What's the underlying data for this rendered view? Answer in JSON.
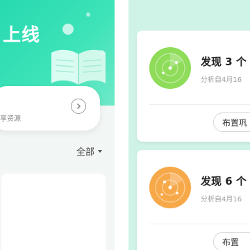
{
  "left_panel": {
    "hero_title": "上线",
    "hero_card_subtitle": "享资源",
    "filter_label": "全部"
  },
  "right_panel": {
    "cards": [
      {
        "title": "发现 3 个",
        "subtitle": "分析自4月16",
        "button_label": "布置巩",
        "radar_color": "#8fdc5a"
      },
      {
        "title": "发现 6 个",
        "subtitle": "分析自4月16",
        "button_label": "布置",
        "radar_color": "#f7a94a"
      }
    ]
  },
  "colors": {
    "brand_green": "#2fdcb1",
    "panel_bg_right": "#cff3e6"
  }
}
